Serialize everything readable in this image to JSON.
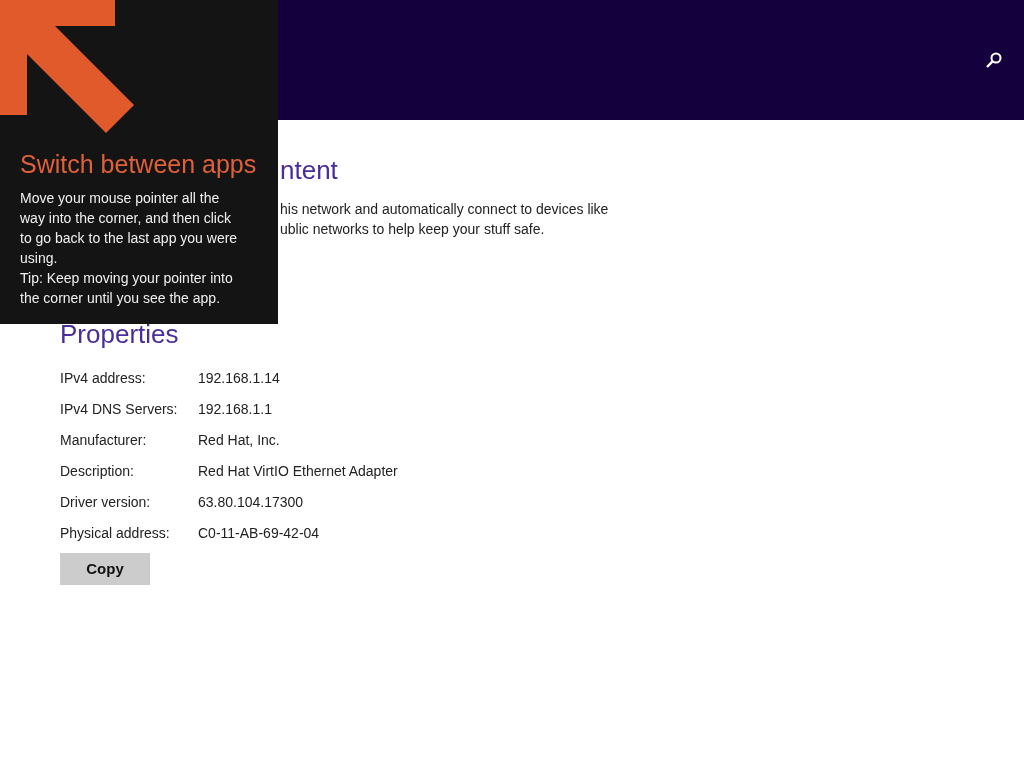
{
  "content": {
    "heading": "ntent",
    "text_lines": [
      "his network and automatically connect to devices like",
      "ublic networks to help keep your stuff safe."
    ]
  },
  "properties": {
    "heading": "Properties",
    "rows": [
      {
        "label": "IPv4 address:",
        "value": "192.168.1.14"
      },
      {
        "label": "IPv4 DNS Servers:",
        "value": "192.168.1.1"
      },
      {
        "label": "Manufacturer:",
        "value": "Red Hat, Inc."
      },
      {
        "label": "Description:",
        "value": "Red Hat VirtIO Ethernet Adapter"
      },
      {
        "label": "Driver version:",
        "value": "63.80.104.17300"
      },
      {
        "label": "Physical address:",
        "value": "C0-11-AB-69-42-04"
      }
    ],
    "button": "Copy"
  },
  "tip": {
    "title": "Switch between apps",
    "body": [
      "Move your mouse pointer all the way into the corner, and then click to go back to the last app you were using.",
      "Tip: Keep moving your pointer into the corner until you see the app."
    ]
  }
}
